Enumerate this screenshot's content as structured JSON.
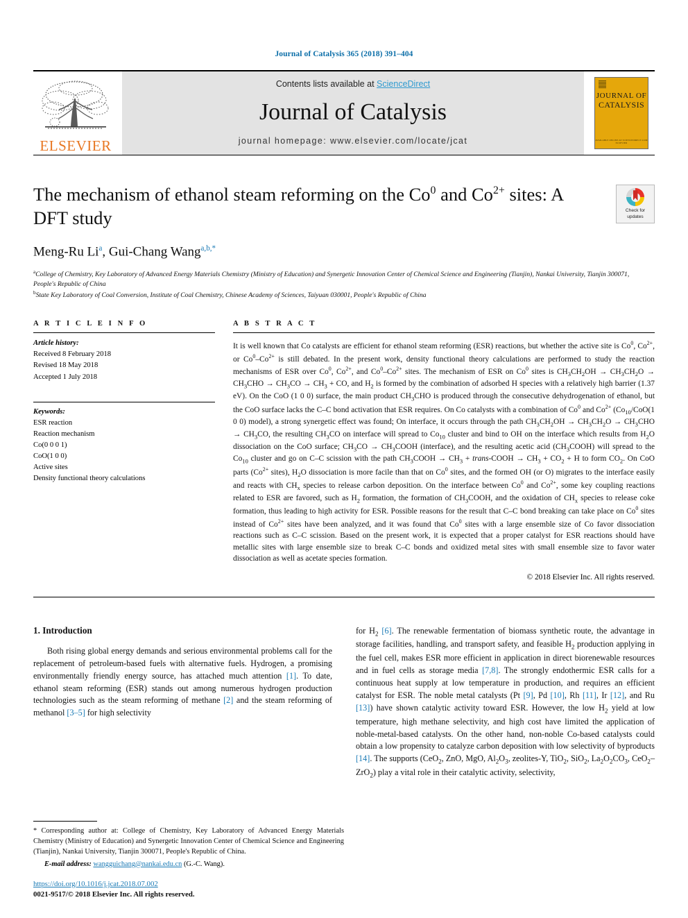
{
  "running_head": "Journal of Catalysis 365 (2018) 391–404",
  "masthead": {
    "elsevier_logo_word": "ELSEVIER",
    "contents_prefix": "Contents lists available at ",
    "sciencedirect": "ScienceDirect",
    "journal_name": "Journal of Catalysis",
    "homepage": "journal homepage: www.elsevier.com/locate/jcat",
    "cover": {
      "line1": "JOURNAL OF",
      "line2": "CATALYSIS",
      "footer1": "AVAILABLE ONLINE AT SCIENCEDIRECT.COM",
      "footer2": "ELSEVIER"
    }
  },
  "crossmark": {
    "label_line1": "Check for",
    "label_line2": "updates"
  },
  "article": {
    "title_part1": "The mechanism of ethanol steam reforming on the Co",
    "title_sup1": "0",
    "title_part2": " and Co",
    "title_sup2": "2+",
    "title_part3": " sites: A DFT study",
    "authors_text": "Meng-Ru Li",
    "author1_sup": "a",
    "authors_sep": ", Gui-Chang Wang",
    "author2_sup": "a,b,",
    "author2_star": "*",
    "affiliation_a_marker": "a",
    "affiliation_a": "College of Chemistry, Key Laboratory of Advanced Energy Materials Chemistry (Ministry of Education) and Synergetic Innovation Center of Chemical Science and Engineering (Tianjin), Nankai University, Tianjin 300071, People's Republic of China",
    "affiliation_b_marker": "b",
    "affiliation_b": "State Key Laboratory of Coal Conversion, Institute of Coal Chemistry, Chinese Academy of Sciences, Taiyuan 030001, People's Republic of China"
  },
  "article_info": {
    "heading": "A R T I C L E   I N F O",
    "history_label": "Article history:",
    "history": [
      "Received 8 February 2018",
      "Revised 18 May 2018",
      "Accepted 1 July 2018"
    ],
    "keywords_label": "Keywords:",
    "keywords": [
      "ESR reaction",
      "Reaction mechanism",
      "Co(0 0 0 1)",
      "CoO(1 0 0)",
      "Active sites",
      "Density functional theory calculations"
    ]
  },
  "abstract": {
    "heading": "A B S T R A C T",
    "copyright": "© 2018 Elsevier Inc. All rights reserved."
  },
  "introduction": {
    "heading": "1. Introduction",
    "left_par": "Both rising global energy demands and serious environmental problems call for the replacement of petroleum-based fuels with alternative fuels. Hydrogen, a promising environmentally friendly energy source, has attached much attention [1]. To date, ethanol steam reforming (ESR) stands out among numerous hydrogen production technologies such as the steam reforming of methane [2] and the steam reforming of methanol [3–5] for high selectivity"
  },
  "footnote": {
    "star": "*",
    "text": "Corresponding author at: College of Chemistry, Key Laboratory of Advanced Energy Materials Chemistry (Ministry of Education) and Synergetic Innovation Center of Chemical Science and Engineering (Tianjin), Nankai University, Tianjin 300071, People's Republic of China.",
    "email_label": "E-mail address:",
    "email": "wangguichang@nankai.edu.cn",
    "email_suffix": "(G.-C. Wang)."
  },
  "publication": {
    "doi": "https://doi.org/10.1016/j.jcat.2018.07.002",
    "issn_line": "0021-9517/© 2018 Elsevier Inc. All rights reserved."
  },
  "colors": {
    "link_blue": "#1a7ab5",
    "sciencedirect_blue": "#2e9ad0",
    "elsevier_orange": "#E87722",
    "cover_yellow": "#E5A70B",
    "masthead_grey": "#e3e3e3"
  }
}
